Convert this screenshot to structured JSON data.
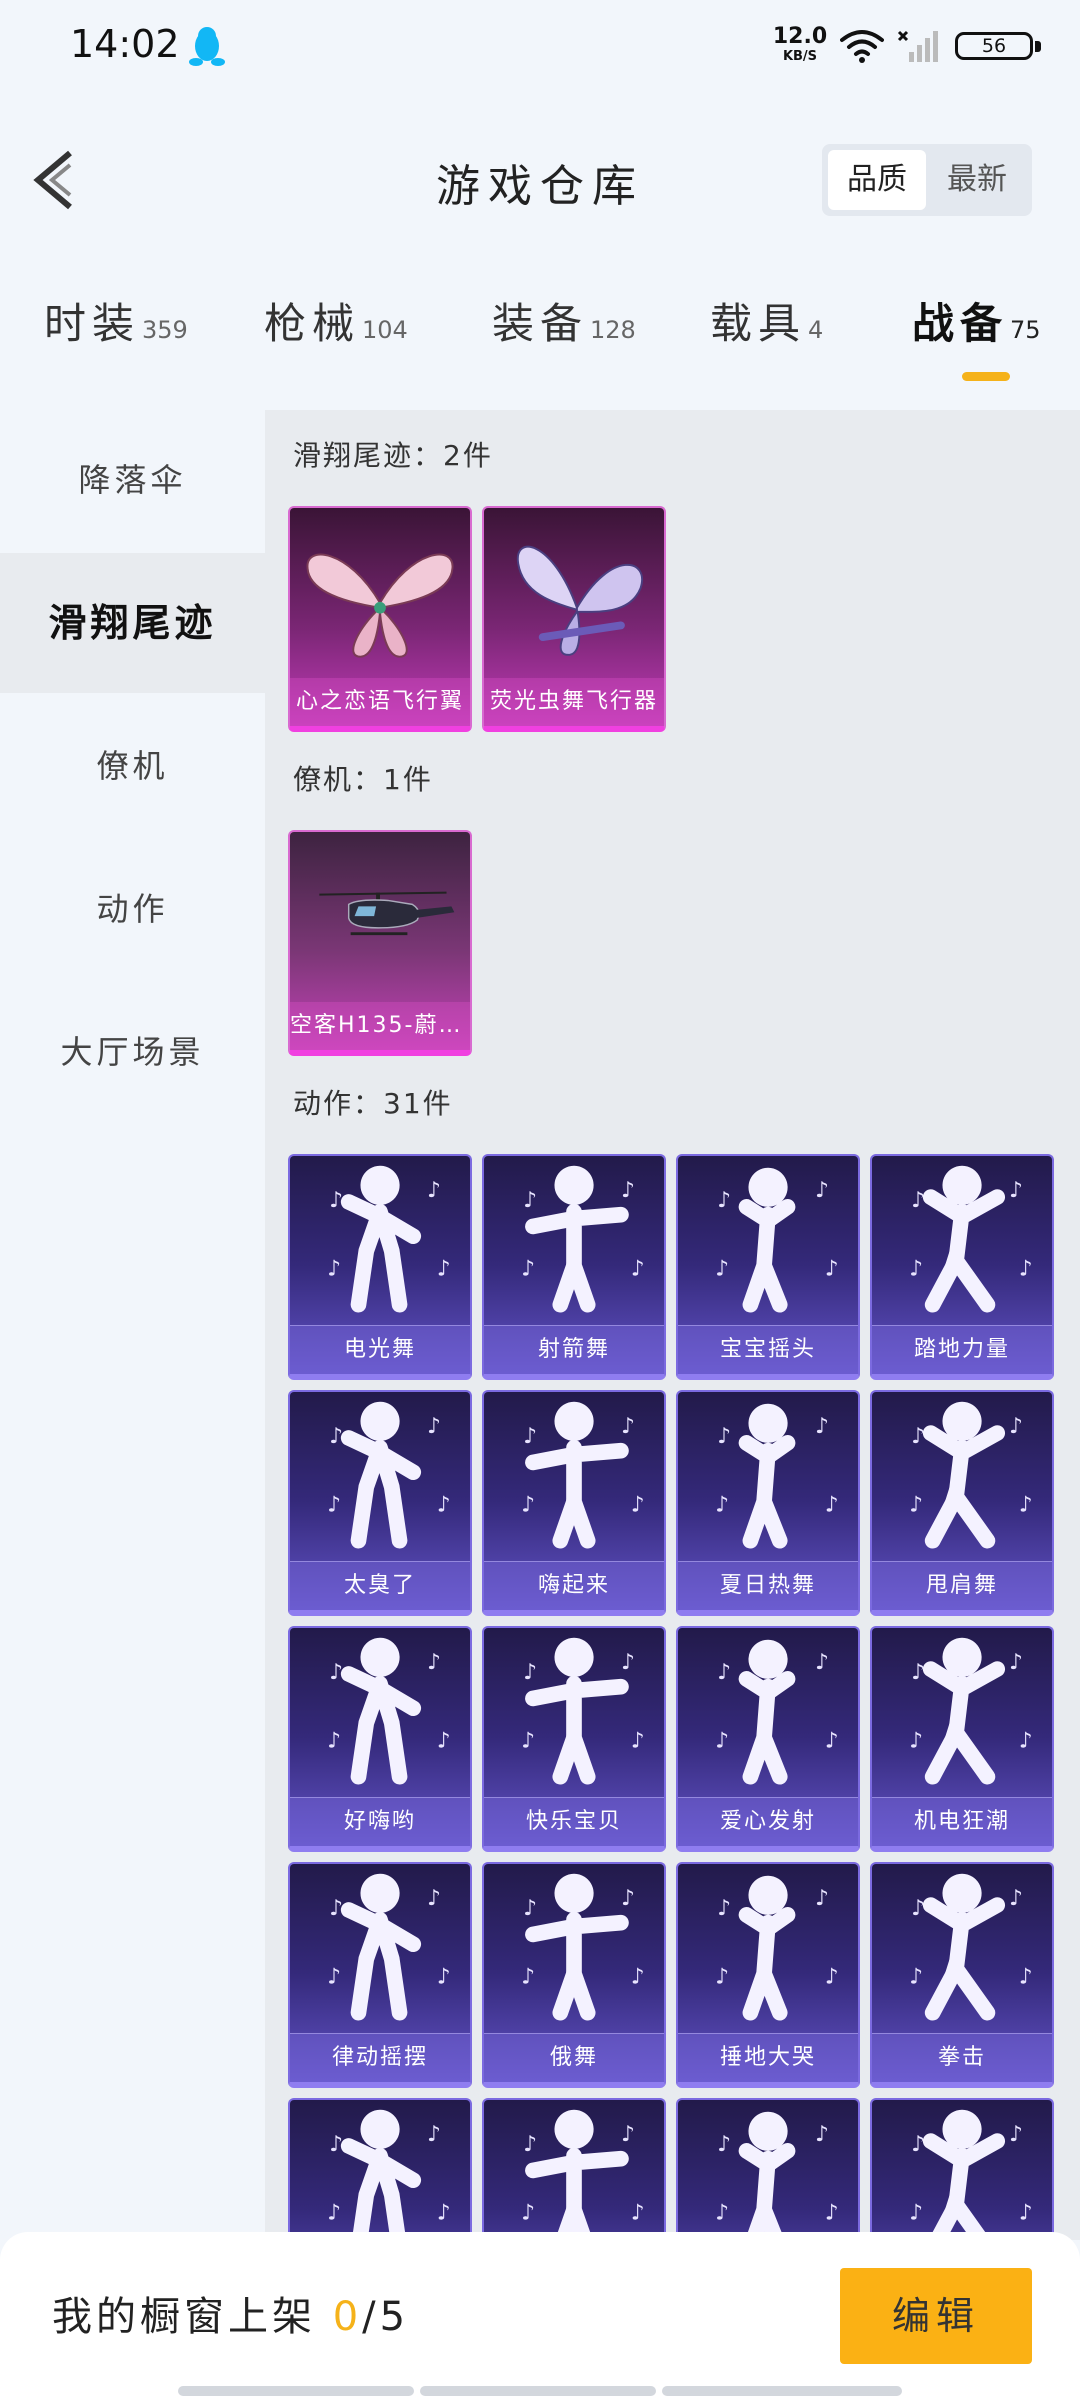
{
  "status_bar": {
    "time": "14:02",
    "net_speed_value": "12.0",
    "net_speed_unit": "KB/S",
    "battery": "56",
    "icons": [
      "qq-penguin-icon",
      "wifi-icon",
      "signal-icon",
      "battery-icon"
    ]
  },
  "header": {
    "title": "游戏仓库",
    "sort_options": [
      {
        "label": "品质",
        "active": true
      },
      {
        "label": "最新",
        "active": false
      }
    ]
  },
  "category_tabs": [
    {
      "label": "时装",
      "count": "359",
      "active": false
    },
    {
      "label": "枪械",
      "count": "104",
      "active": false
    },
    {
      "label": "装备",
      "count": "128",
      "active": false
    },
    {
      "label": "载具",
      "count": "4",
      "active": false
    },
    {
      "label": "战备",
      "count": "75",
      "active": true
    }
  ],
  "sidebar": {
    "items": [
      {
        "label": "降落伞",
        "active": false
      },
      {
        "label": "滑翔尾迹",
        "active": true
      },
      {
        "label": "僚机",
        "active": false
      },
      {
        "label": "动作",
        "active": false
      },
      {
        "label": "大厅场景",
        "active": false
      }
    ]
  },
  "sections": {
    "glide": {
      "label": "滑翔尾迹：2件",
      "items": [
        {
          "name": "心之恋语飞行翼",
          "art": "pink-butterfly-wings"
        },
        {
          "name": "荧光虫舞飞行器",
          "art": "purple-butterfly-glider"
        }
      ]
    },
    "wingman": {
      "label": "僚机：1件",
      "items": [
        {
          "name": "空客H135-蔚蓝…",
          "art": "helicopter"
        }
      ]
    },
    "emotes": {
      "label": "动作：31件",
      "items": [
        {
          "name": "电光舞"
        },
        {
          "name": "射箭舞"
        },
        {
          "name": "宝宝摇头"
        },
        {
          "name": "踏地力量"
        },
        {
          "name": "太臭了"
        },
        {
          "name": "嗨起来"
        },
        {
          "name": "夏日热舞"
        },
        {
          "name": "甩肩舞"
        },
        {
          "name": "好嗨哟"
        },
        {
          "name": "快乐宝贝"
        },
        {
          "name": "爱心发射"
        },
        {
          "name": "机电狂潮"
        },
        {
          "name": "律动摇摆"
        },
        {
          "name": "俄舞"
        },
        {
          "name": "捶地大哭"
        },
        {
          "name": "拳击"
        },
        {
          "name": ""
        },
        {
          "name": ""
        },
        {
          "name": ""
        },
        {
          "name": ""
        }
      ]
    }
  },
  "bottom_bar": {
    "showcase_label": "我的橱窗上架",
    "current": "0",
    "total": "/5",
    "edit_label": "编辑"
  },
  "colors": {
    "accent": "#f5b21a",
    "edit_button": "#fbb114",
    "pink_card": "#c13bb8",
    "purple_card": "#6253c7"
  }
}
